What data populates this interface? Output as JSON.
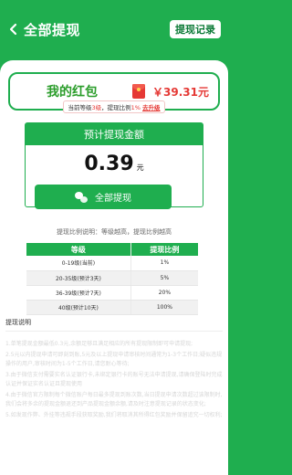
{
  "header": {
    "title": "全部提现",
    "record_button": "提现记录"
  },
  "redpack": {
    "label": "我的红包",
    "balance": "￥39.31元"
  },
  "level_notice": {
    "prefix": "当前等级",
    "level": "3级",
    "middle": "，提现比例",
    "ratio": "1%",
    "upgrade": "去升级"
  },
  "estimate": {
    "title": "预计提现金额",
    "amount": "0.39",
    "unit": "元",
    "button": "全部提现"
  },
  "ratio_desc": "提现比例说明：等级越高，提现比例越高",
  "table": {
    "headers": [
      "等级",
      "提现比例"
    ],
    "rows": [
      {
        "level": "0-19级(当前)",
        "ratio": "1%"
      },
      {
        "level": "20-35级(预计3天)",
        "ratio": "5%"
      },
      {
        "level": "36-39级(预计7天)",
        "ratio": "20%"
      },
      {
        "level": "40级(预计10天)",
        "ratio": "100%"
      }
    ]
  },
  "notes": {
    "title": "提现说明",
    "items": [
      "1.单笔提现金额最低0.3元,余额足够且满足相应的所有提现限制即可申请提现;",
      "2.5元以内提现申请可即刻到账,5元及以上提现申请审核时间通常为1-3个工作日;疑似违规操作的用户,审核时间为1-5个工作日,请您耐心等待;",
      "3.由于微信支付需要实名认证银行卡,未绑定银行卡的账号无法申请提现,请确保登陆时完成认证并保证实名认证且提现使用",
      "4.由于微信官方限制每个微信账户每日最多提现到账次数,当日提现申请次数超过该限制时,我们会将多余的提现金额退还到产品提现金额余额,请及时注意提现记录的状态变化;",
      "5.如发现作弊、外挂等违规手段获取奖励,我们将取消其所得红包奖励并保留追究一切权利;"
    ]
  }
}
